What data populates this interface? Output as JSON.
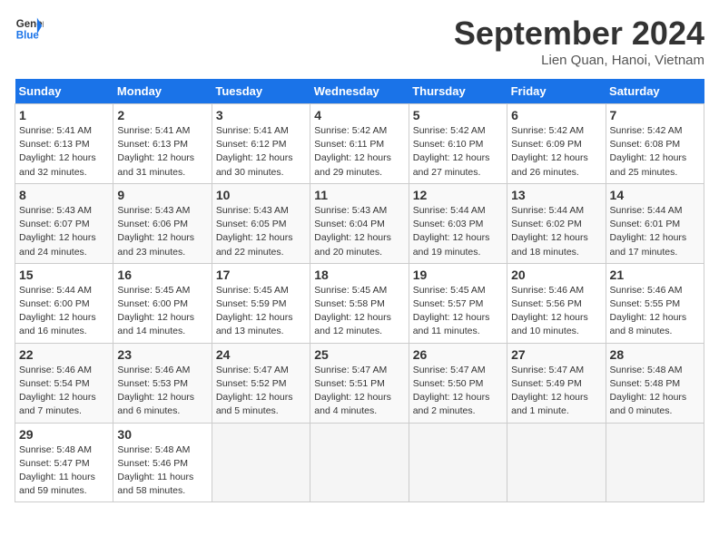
{
  "header": {
    "logo_line1": "General",
    "logo_line2": "Blue",
    "month_title": "September 2024",
    "subtitle": "Lien Quan, Hanoi, Vietnam"
  },
  "weekdays": [
    "Sunday",
    "Monday",
    "Tuesday",
    "Wednesday",
    "Thursday",
    "Friday",
    "Saturday"
  ],
  "weeks": [
    [
      {
        "day": "1",
        "sunrise": "5:41 AM",
        "sunset": "6:13 PM",
        "daylight": "12 hours and 32 minutes."
      },
      {
        "day": "2",
        "sunrise": "5:41 AM",
        "sunset": "6:13 PM",
        "daylight": "12 hours and 31 minutes."
      },
      {
        "day": "3",
        "sunrise": "5:41 AM",
        "sunset": "6:12 PM",
        "daylight": "12 hours and 30 minutes."
      },
      {
        "day": "4",
        "sunrise": "5:42 AM",
        "sunset": "6:11 PM",
        "daylight": "12 hours and 29 minutes."
      },
      {
        "day": "5",
        "sunrise": "5:42 AM",
        "sunset": "6:10 PM",
        "daylight": "12 hours and 27 minutes."
      },
      {
        "day": "6",
        "sunrise": "5:42 AM",
        "sunset": "6:09 PM",
        "daylight": "12 hours and 26 minutes."
      },
      {
        "day": "7",
        "sunrise": "5:42 AM",
        "sunset": "6:08 PM",
        "daylight": "12 hours and 25 minutes."
      }
    ],
    [
      {
        "day": "8",
        "sunrise": "5:43 AM",
        "sunset": "6:07 PM",
        "daylight": "12 hours and 24 minutes."
      },
      {
        "day": "9",
        "sunrise": "5:43 AM",
        "sunset": "6:06 PM",
        "daylight": "12 hours and 23 minutes."
      },
      {
        "day": "10",
        "sunrise": "5:43 AM",
        "sunset": "6:05 PM",
        "daylight": "12 hours and 22 minutes."
      },
      {
        "day": "11",
        "sunrise": "5:43 AM",
        "sunset": "6:04 PM",
        "daylight": "12 hours and 20 minutes."
      },
      {
        "day": "12",
        "sunrise": "5:44 AM",
        "sunset": "6:03 PM",
        "daylight": "12 hours and 19 minutes."
      },
      {
        "day": "13",
        "sunrise": "5:44 AM",
        "sunset": "6:02 PM",
        "daylight": "12 hours and 18 minutes."
      },
      {
        "day": "14",
        "sunrise": "5:44 AM",
        "sunset": "6:01 PM",
        "daylight": "12 hours and 17 minutes."
      }
    ],
    [
      {
        "day": "15",
        "sunrise": "5:44 AM",
        "sunset": "6:00 PM",
        "daylight": "12 hours and 16 minutes."
      },
      {
        "day": "16",
        "sunrise": "5:45 AM",
        "sunset": "6:00 PM",
        "daylight": "12 hours and 14 minutes."
      },
      {
        "day": "17",
        "sunrise": "5:45 AM",
        "sunset": "5:59 PM",
        "daylight": "12 hours and 13 minutes."
      },
      {
        "day": "18",
        "sunrise": "5:45 AM",
        "sunset": "5:58 PM",
        "daylight": "12 hours and 12 minutes."
      },
      {
        "day": "19",
        "sunrise": "5:45 AM",
        "sunset": "5:57 PM",
        "daylight": "12 hours and 11 minutes."
      },
      {
        "day": "20",
        "sunrise": "5:46 AM",
        "sunset": "5:56 PM",
        "daylight": "12 hours and 10 minutes."
      },
      {
        "day": "21",
        "sunrise": "5:46 AM",
        "sunset": "5:55 PM",
        "daylight": "12 hours and 8 minutes."
      }
    ],
    [
      {
        "day": "22",
        "sunrise": "5:46 AM",
        "sunset": "5:54 PM",
        "daylight": "12 hours and 7 minutes."
      },
      {
        "day": "23",
        "sunrise": "5:46 AM",
        "sunset": "5:53 PM",
        "daylight": "12 hours and 6 minutes."
      },
      {
        "day": "24",
        "sunrise": "5:47 AM",
        "sunset": "5:52 PM",
        "daylight": "12 hours and 5 minutes."
      },
      {
        "day": "25",
        "sunrise": "5:47 AM",
        "sunset": "5:51 PM",
        "daylight": "12 hours and 4 minutes."
      },
      {
        "day": "26",
        "sunrise": "5:47 AM",
        "sunset": "5:50 PM",
        "daylight": "12 hours and 2 minutes."
      },
      {
        "day": "27",
        "sunrise": "5:47 AM",
        "sunset": "5:49 PM",
        "daylight": "12 hours and 1 minute."
      },
      {
        "day": "28",
        "sunrise": "5:48 AM",
        "sunset": "5:48 PM",
        "daylight": "12 hours and 0 minutes."
      }
    ],
    [
      {
        "day": "29",
        "sunrise": "5:48 AM",
        "sunset": "5:47 PM",
        "daylight": "11 hours and 59 minutes."
      },
      {
        "day": "30",
        "sunrise": "5:48 AM",
        "sunset": "5:46 PM",
        "daylight": "11 hours and 58 minutes."
      },
      null,
      null,
      null,
      null,
      null
    ]
  ]
}
